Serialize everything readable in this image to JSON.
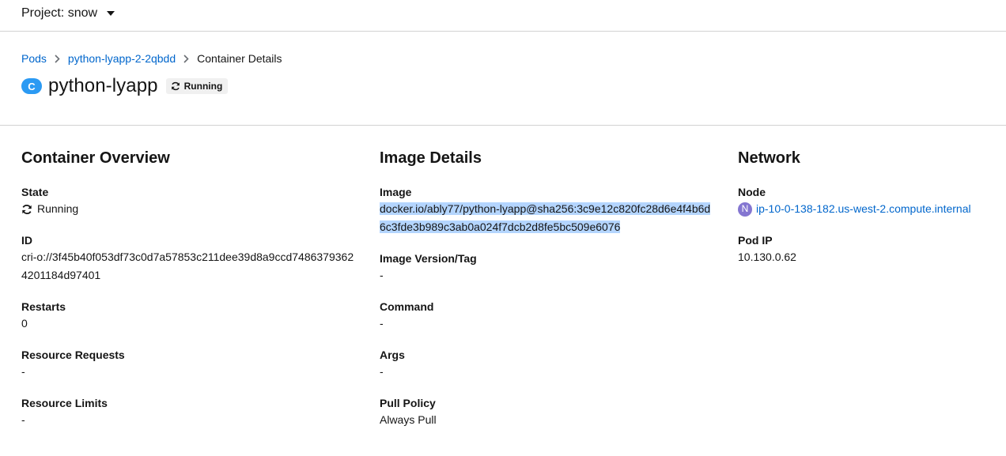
{
  "header": {
    "project_label": "Project: snow"
  },
  "breadcrumb": {
    "items": [
      "Pods",
      "python-lyapp-2-2qbdd"
    ],
    "current": "Container Details"
  },
  "resource": {
    "kind_badge": "C",
    "name": "python-lyapp",
    "status": "Running"
  },
  "overview": {
    "title": "Container Overview",
    "state_label": "State",
    "state_value": "Running",
    "id_label": "ID",
    "id_value": "cri-o://3f45b40f053df73c0d7a57853c211dee39d8a9ccd74863793624201184d97401",
    "restarts_label": "Restarts",
    "restarts_value": "0",
    "requests_label": "Resource Requests",
    "requests_value": "-",
    "limits_label": "Resource Limits",
    "limits_value": "-"
  },
  "image": {
    "title": "Image Details",
    "image_label": "Image",
    "image_value": "docker.io/ably77/python-lyapp@sha256:3c9e12c820fc28d6e4f4b6d6c3fde3b989c3ab0a024f7dcb2d8fe5bc509e6076",
    "tag_label": "Image Version/Tag",
    "tag_value": "-",
    "command_label": "Command",
    "command_value": "-",
    "args_label": "Args",
    "args_value": "-",
    "pull_label": "Pull Policy",
    "pull_value": "Always Pull"
  },
  "network": {
    "title": "Network",
    "node_label": "Node",
    "node_badge": "N",
    "node_value": "ip-10-0-138-182.us-west-2.compute.internal",
    "podip_label": "Pod IP",
    "podip_value": "10.130.0.62"
  },
  "icons": {
    "running": "sync-icon",
    "breadcrumb_separator": "chevron-right-icon",
    "dropdown": "caret-down-icon"
  },
  "colors": {
    "link": "#0066cc",
    "container_badge": "#2b9af3",
    "node_badge": "#8476d1",
    "selection": "#b4d5fe"
  }
}
